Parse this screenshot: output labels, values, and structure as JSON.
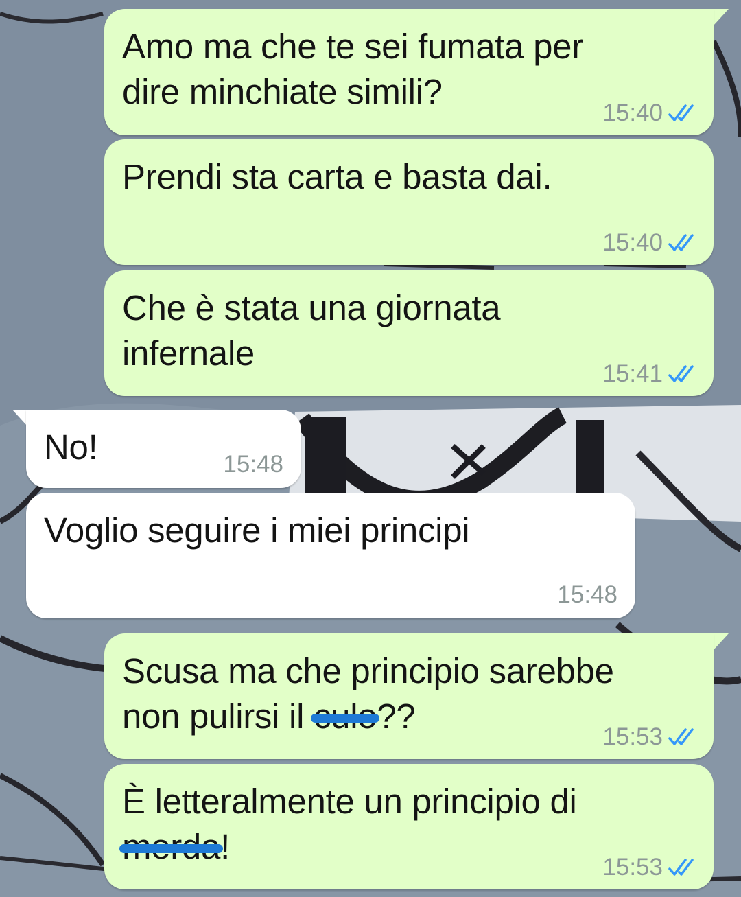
{
  "chat": {
    "messages": [
      {
        "direction": "out",
        "lines": [
          "Amo ma che te sei fumata per",
          "dire minchiate simili?"
        ],
        "time": "15:40",
        "status": "read"
      },
      {
        "direction": "out",
        "lines": [
          "Prendi sta carta e basta dai."
        ],
        "time": "15:40",
        "status": "read"
      },
      {
        "direction": "out",
        "lines": [
          "Che è stata una giornata",
          "infernale"
        ],
        "time": "15:41",
        "status": "read"
      },
      {
        "direction": "in",
        "lines": [
          "No!"
        ],
        "time": "15:48"
      },
      {
        "direction": "in",
        "lines": [
          "Voglio seguire i miei principi"
        ],
        "time": "15:48"
      },
      {
        "direction": "out",
        "line1": "Scusa ma che principio sarebbe",
        "line2_pre": "non pulirsi il ",
        "line2_redacted": "culo",
        "line2_post": "??",
        "time": "15:53",
        "status": "read"
      },
      {
        "direction": "out",
        "line1": "È letteralmente un principio di",
        "line2_redacted": "merda",
        "line2_post": "!",
        "time": "15:53",
        "status": "read"
      }
    ]
  },
  "colors": {
    "outgoing_bubble": "#e2ffc8",
    "incoming_bubble": "#ffffff",
    "read_ticks": "#3497f9",
    "timestamp": "#8c9796",
    "redaction_marker": "#1e7ad6"
  },
  "icons": {
    "read_status": "double-check-icon"
  }
}
